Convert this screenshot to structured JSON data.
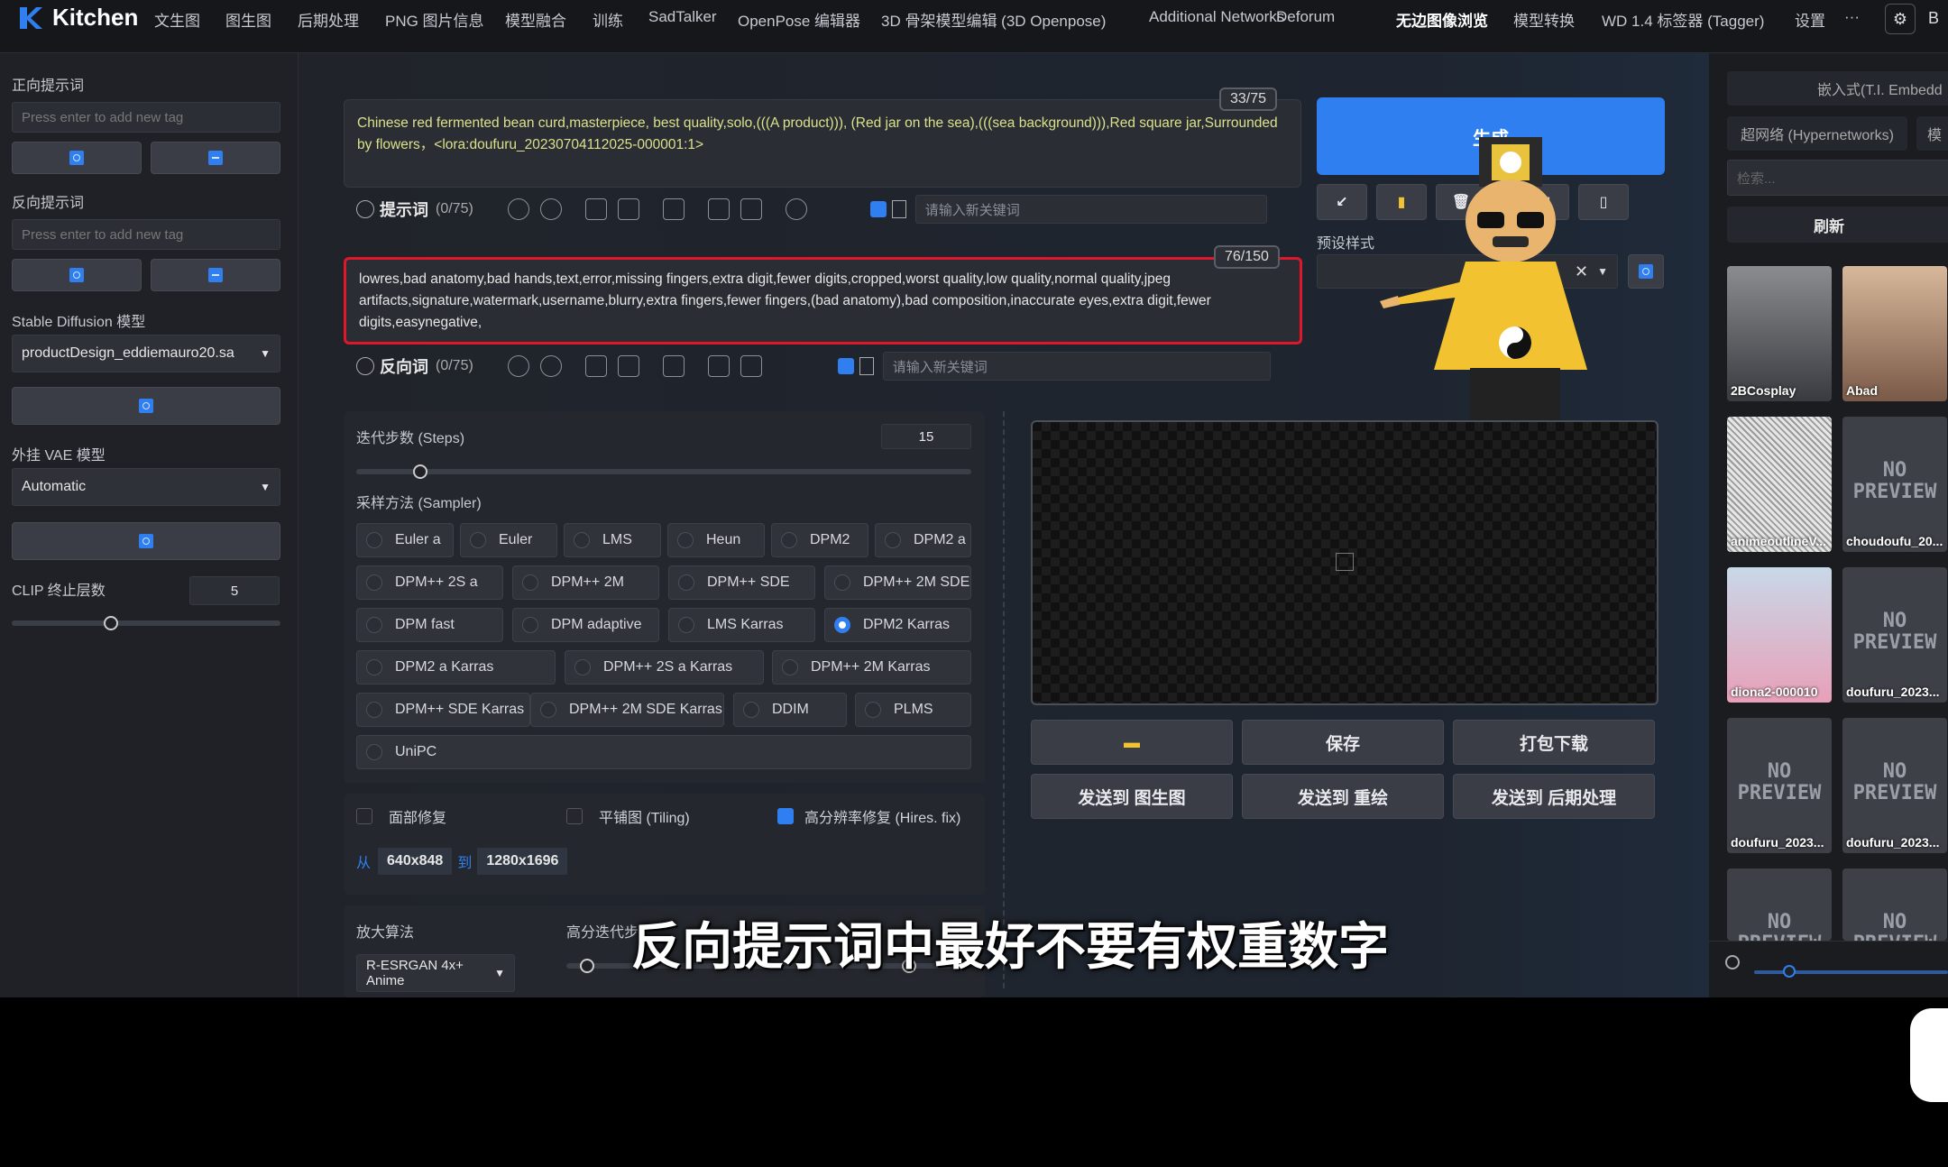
{
  "nav": {
    "logo": "Kitchen",
    "tabs": [
      "文生图",
      "图生图",
      "后期处理",
      "PNG 图片信息",
      "模型融合",
      "训练",
      "SadTalker",
      "OpenPose 编辑器",
      "3D 骨架模型编辑 (3D Openpose)",
      "Additional Networks",
      "Deforum",
      "无边图像浏览",
      "模型转换",
      "WD 1.4 标签器 (Tagger)",
      "设置",
      "···"
    ],
    "active_tab": "无边图像浏览"
  },
  "sidebar": {
    "pos_prompt_label": "正向提示词",
    "pos_tag_placeholder": "Press enter to add new tag",
    "neg_prompt_label": "反向提示词",
    "neg_tag_placeholder": "Press enter to add new tag",
    "sd_model_label": "Stable Diffusion 模型",
    "sd_model_value": "productDesign_eddiemauro20.sa",
    "vae_label": "外挂 VAE 模型",
    "vae_value": "Automatic",
    "clip_label": "CLIP 终止层数",
    "clip_value": "5",
    "clip_level": 0.5
  },
  "prompt": {
    "positive_text": "Chinese red fermented bean curd,masterpiece, best quality,solo,(((A product))), (Red jar on the sea),(((sea background))),Red square jar,Surrounded by flowers，<lora:doufuru_20230704112025-000001:1>",
    "positive_counter": "33/75",
    "positive_label": "提示词",
    "positive_count": "(0/75)",
    "negative_text": "lowres,bad anatomy,bad hands,text,error,missing fingers,extra digit,fewer digits,cropped,worst quality,low quality,normal quality,jpeg artifacts,signature,watermark,username,blurry,extra fingers,fewer fingers,(bad anatomy),bad composition,inaccurate eyes,extra digit,fewer digits,easynegative,",
    "negative_counter": "76/150",
    "negative_label": "反向词",
    "negative_count": "(0/75)",
    "keyword_placeholder": "请输入新关键词"
  },
  "generate": {
    "button": "生成",
    "preset_label": "预设样式",
    "tool_buttons": [
      "↙",
      "▮",
      "🗑",
      "▦",
      "▯"
    ]
  },
  "settings": {
    "steps_label": "迭代步数 (Steps)",
    "steps_value": "15",
    "sampler_label": "采样方法 (Sampler)",
    "samplers": [
      "Euler a",
      "Euler",
      "LMS",
      "Heun",
      "DPM2",
      "DPM2 a",
      "DPM++ 2S a",
      "DPM++ 2M",
      "DPM++ SDE",
      "DPM++ 2M SDE",
      "DPM fast",
      "DPM adaptive",
      "LMS Karras",
      "DPM2 Karras",
      "DPM2 a Karras",
      "DPM++ 2S a Karras",
      "DPM++ 2M Karras",
      "DPM++ SDE Karras",
      "DPM++ 2M SDE Karras",
      "DDIM",
      "PLMS",
      "UniPC"
    ],
    "selected_sampler": "DPM2 Karras",
    "face_restore": "面部修复",
    "tiling": "平铺图 (Tiling)",
    "hires_fix": "高分辨率修复 (Hires. fix)",
    "res_from_label": "从",
    "res_from": "640x848",
    "res_to_label": "到",
    "res_to": "1280x1696",
    "upscaler_label": "放大算法",
    "upscaler_value": "R-ESRGAN 4x+ Anime",
    "hires_steps_label": "高分迭代步"
  },
  "output": {
    "folder_icon": "folder-icon",
    "save": "保存",
    "zip": "打包下载",
    "send_img2img": "发送到 图生图",
    "send_inpaint": "发送到 重绘",
    "send_extras": "发送到 后期处理"
  },
  "right": {
    "tab_embed": "嵌入式(T.I. Embedd",
    "tab_hyper": "超网络 (Hypernetworks)",
    "tab_other": "模",
    "search_placeholder": "检索...",
    "refresh": "刷新",
    "no_preview": "NO PREVIEW",
    "cards": [
      "2BCosplay",
      "Abad",
      "animeoutlineV...",
      "choudoufu_20...",
      "diona2-000010",
      "doufuru_2023...",
      "doufuru_2023...",
      "doufuru_2023...",
      "",
      ""
    ]
  },
  "subtitle": "反向提示词中最好不要有权重数字"
}
